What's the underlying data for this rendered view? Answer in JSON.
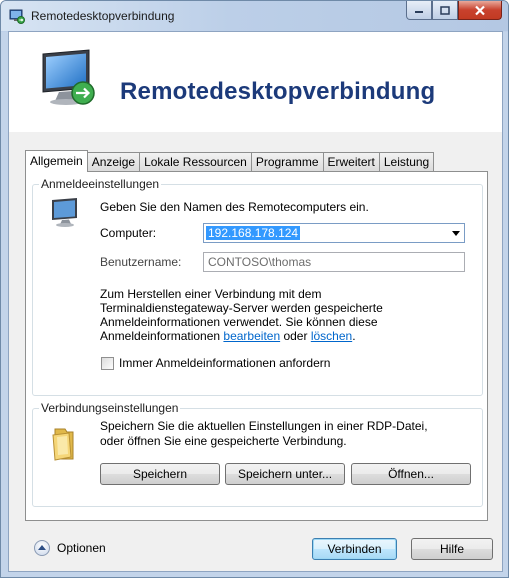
{
  "window": {
    "title": "Remotedesktopverbindung"
  },
  "banner": {
    "title": "Remotedesktopverbindung"
  },
  "tabs": [
    {
      "label": "Allgemein",
      "active": true
    },
    {
      "label": "Anzeige",
      "active": false
    },
    {
      "label": "Lokale Ressourcen",
      "active": false
    },
    {
      "label": "Programme",
      "active": false
    },
    {
      "label": "Erweitert",
      "active": false
    },
    {
      "label": "Leistung",
      "active": false
    }
  ],
  "logon": {
    "legend": "Anmeldeeinstellungen",
    "instruction": "Geben Sie den Namen des Remotecomputers ein.",
    "computer_label": "Computer:",
    "computer_value": "192.168.178.124",
    "username_label": "Benutzername:",
    "username_value": "CONTOSO\\thomas",
    "info_line1": "Zum Herstellen einer Verbindung mit dem",
    "info_line2": "Terminaldienstegateway-Server werden gespeicherte",
    "info_line3": "Anmeldeinformationen verwendet. Sie können diese",
    "info_line4_prefix": "Anmeldeinformationen ",
    "edit_link": "bearbeiten",
    "info_line4_mid": " oder ",
    "delete_link": "löschen",
    "info_line4_suffix": ".",
    "always_ask_label": "Immer Anmeldeinformationen anfordern",
    "always_ask_checked": false
  },
  "connection": {
    "legend": "Verbindungseinstellungen",
    "desc_line1": "Speichern Sie die aktuellen Einstellungen in einer RDP-Datei,",
    "desc_line2": "oder öffnen Sie eine gespeicherte Verbindung.",
    "save_label": "Speichern",
    "save_as_label": "Speichern unter...",
    "open_label": "Öffnen..."
  },
  "footer": {
    "options_label": "Optionen",
    "connect_label": "Verbinden",
    "help_label": "Hilfe"
  },
  "colors": {
    "banner_title": "#1c3a7a",
    "link": "#0066cc",
    "selection": "#3399ff",
    "close_button": "#c8412d"
  },
  "icons": {
    "title": "remote-desktop-icon",
    "banner": "remote-desktop-monitor-icon",
    "logon": "computer-monitor-icon",
    "connection": "folder-icon",
    "options": "chevron-up-icon"
  }
}
